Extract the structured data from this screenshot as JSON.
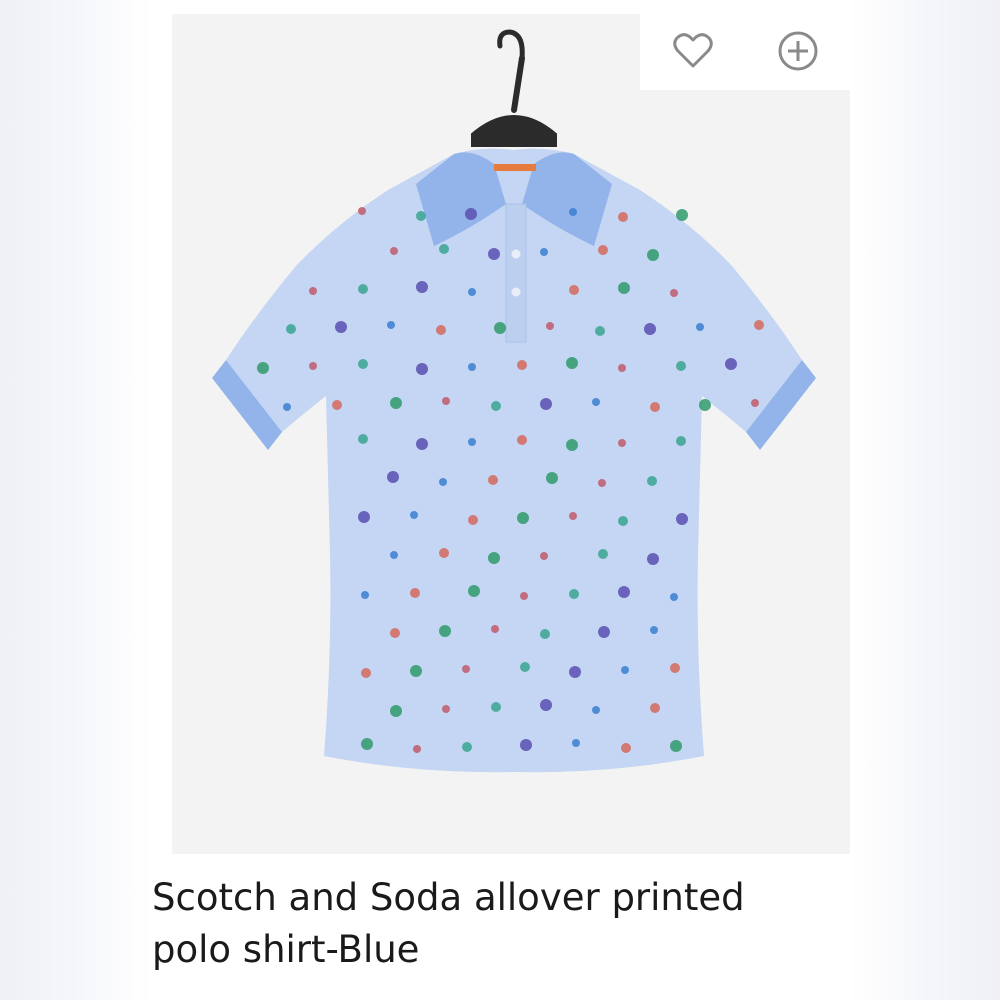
{
  "product": {
    "title_line1": "Scotch and Soda allover printed",
    "title_line2": "polo shirt-Blue",
    "image_subject": "light blue polo shirt with multicolored dot print on hanger"
  },
  "actions": {
    "wishlist_icon": "heart-outline-icon",
    "add_icon": "plus-circle-icon"
  },
  "colors": {
    "shirt": "#bfd3f2",
    "collar": "#8fb2e8",
    "icon_stroke": "#8a8a8a",
    "image_bg": "#f3f3f3"
  }
}
